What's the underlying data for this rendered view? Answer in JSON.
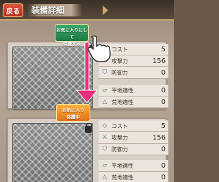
{
  "header": {
    "back_label": "戻る",
    "title": "装備詳細"
  },
  "protect_button_off": {
    "line1": "お気に入りにして",
    "line2": "保護する"
  },
  "protect_button_on": {
    "line1": "お気に入り",
    "line2": "保護中"
  },
  "card1": {
    "stats": [
      {
        "icon": "cost-icon",
        "label": "コスト",
        "value": "5"
      },
      {
        "icon": "sword-icon",
        "label": "攻撃力",
        "value": "156"
      },
      {
        "icon": "shield-icon",
        "label": "防御力",
        "value": "0"
      }
    ],
    "terrain": [
      {
        "icon": "plain-terrain-icon",
        "label": "平地適性",
        "value": "0"
      },
      {
        "icon": "rough-terrain-icon",
        "label": "荒地適性",
        "value": "0"
      }
    ]
  },
  "card2": {
    "stats": [
      {
        "icon": "cost-icon",
        "label": "コスト",
        "value": "5"
      },
      {
        "icon": "sword-icon",
        "label": "攻撃力",
        "value": "156"
      },
      {
        "icon": "shield-icon",
        "label": "防御力",
        "value": "0"
      }
    ],
    "terrain": [
      {
        "icon": "plain-terrain-icon",
        "label": "平地適性",
        "value": "0"
      },
      {
        "icon": "rough-terrain-icon",
        "label": "荒地適性",
        "value": "0"
      }
    ]
  },
  "colors": {
    "arrow": "#e8307a",
    "protect_off": "#2a9a5a",
    "protect_on": "#f08a2a"
  }
}
